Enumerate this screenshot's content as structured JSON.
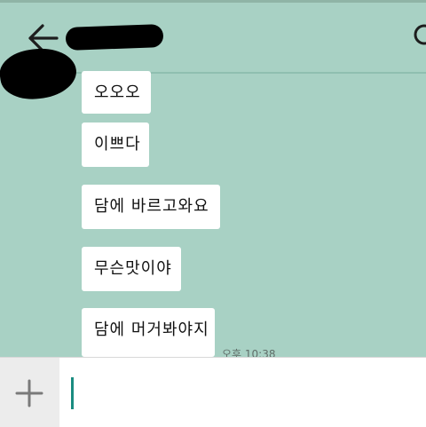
{
  "colors": {
    "chat_background": "#a8d1c4",
    "header_background": "#a8d1c4",
    "bubble_background": "#ffffff",
    "accent": "#1a8c80"
  },
  "header": {
    "back_icon": "arrow-left-icon",
    "search_icon": "search-icon"
  },
  "messages": [
    {
      "text": "오오오"
    },
    {
      "text": "이쁘다"
    },
    {
      "text": "담에 바르고와요"
    },
    {
      "text": "무슨맛이야"
    },
    {
      "text": "담에 머거봐야지"
    }
  ],
  "last_message_time": "오후 10:38",
  "input": {
    "attach_icon": "plus-icon",
    "value": ""
  }
}
